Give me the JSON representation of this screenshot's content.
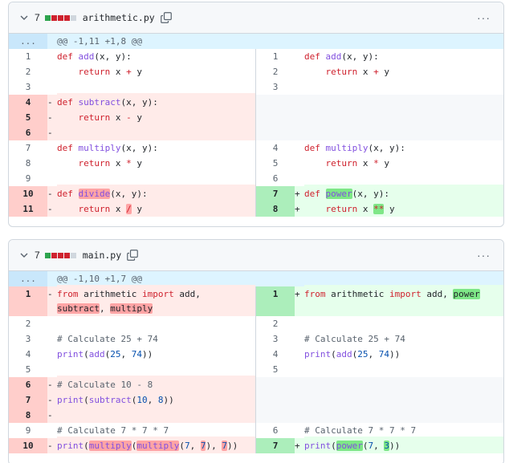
{
  "files": [
    {
      "changes": "7",
      "name": "arithmetic.py",
      "more": "···",
      "hunk": {
        "num": "...",
        "text": "@@ -1,11 +1,8 @@"
      }
    },
    {
      "changes": "7",
      "name": "main.py",
      "more": "···",
      "hunk": {
        "num": "...",
        "text": "@@ -1,10 +1,7 @@"
      }
    }
  ],
  "colors": {
    "added": "#2da44e",
    "deleted": "#cf222e",
    "neutral": "#d0d7de"
  },
  "icons": {
    "collapse": "chevron-down-icon",
    "copy": "copy-icon",
    "more": "kebab-horizontal-icon"
  }
}
